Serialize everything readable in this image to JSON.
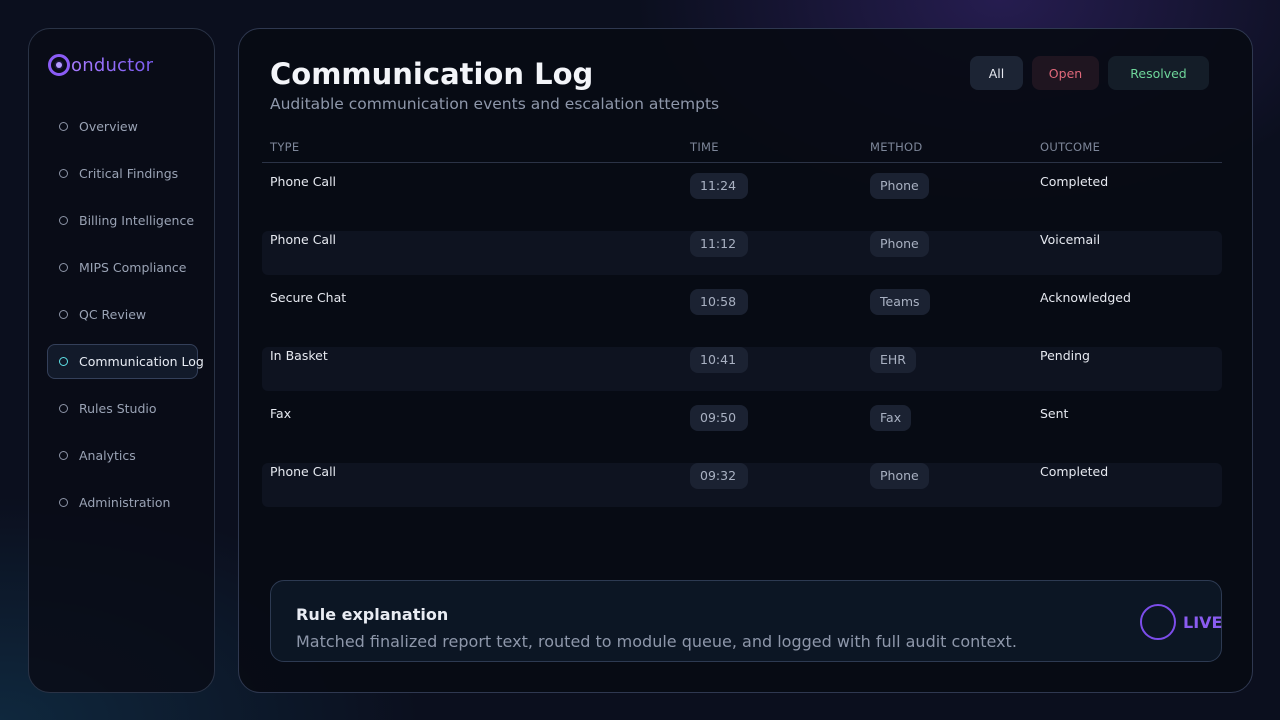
{
  "brand": {
    "name": "Conductor"
  },
  "sidebar": {
    "items": [
      {
        "label": "Overview"
      },
      {
        "label": "Critical Findings"
      },
      {
        "label": "Billing Intelligence"
      },
      {
        "label": "MIPS Compliance"
      },
      {
        "label": "QC Review"
      },
      {
        "label": "Communication Log",
        "active": true
      },
      {
        "label": "Rules Studio"
      },
      {
        "label": "Analytics"
      },
      {
        "label": "Administration"
      }
    ]
  },
  "header": {
    "title": "Communication Log",
    "subtitle": "Auditable communication events and escalation attempts"
  },
  "filters": {
    "all": "All",
    "open": "Open",
    "resolved": "Resolved"
  },
  "table": {
    "columns": [
      "TYPE",
      "TIME",
      "METHOD",
      "OUTCOME"
    ],
    "rows": [
      {
        "type": "Phone Call",
        "time": "11:24",
        "method": "Phone",
        "outcome": "Completed"
      },
      {
        "type": "Phone Call",
        "time": "11:12",
        "method": "Phone",
        "outcome": "Voicemail"
      },
      {
        "type": "Secure Chat",
        "time": "10:58",
        "method": "Teams",
        "outcome": "Acknowledged"
      },
      {
        "type": "In Basket",
        "time": "10:41",
        "method": "EHR",
        "outcome": "Pending"
      },
      {
        "type": "Fax",
        "time": "09:50",
        "method": "Fax",
        "outcome": "Sent"
      },
      {
        "type": "Phone Call",
        "time": "09:32",
        "method": "Phone",
        "outcome": "Completed"
      }
    ]
  },
  "explanation": {
    "title": "Rule explanation",
    "text": "Matched finalized report text, routed to module queue, and logged with full audit context.",
    "status": "LIVE"
  },
  "colors": {
    "accent": "#8b5cf6",
    "active_dot": "#5ee0e6",
    "open": "#e0687a",
    "resolved": "#6ed69a"
  }
}
